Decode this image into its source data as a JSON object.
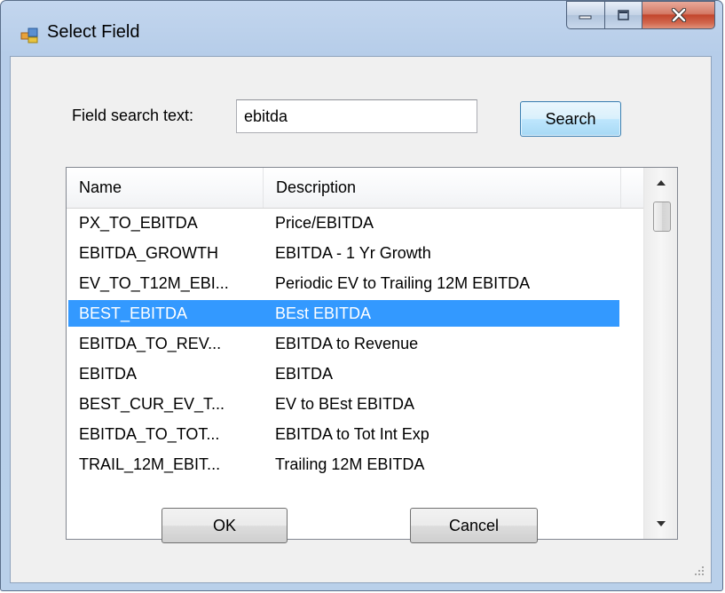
{
  "window": {
    "title": "Select Field",
    "colors": {
      "selection": "#3399ff",
      "title_bar": "#b9d0ea",
      "close_button": "#c2452c"
    }
  },
  "search": {
    "label": "Field search text:",
    "value": "ebitda",
    "button_label": "Search"
  },
  "list": {
    "columns": [
      "Name",
      "Description"
    ],
    "rows": [
      {
        "name": "PX_TO_EBITDA",
        "description": "Price/EBITDA",
        "selected": false
      },
      {
        "name": "EBITDA_GROWTH",
        "description": "EBITDA - 1 Yr Growth",
        "selected": false
      },
      {
        "name": "EV_TO_T12M_EBI...",
        "description": "Periodic EV to Trailing 12M EBITDA",
        "selected": false
      },
      {
        "name": "BEST_EBITDA",
        "description": "BEst EBITDA",
        "selected": true
      },
      {
        "name": "EBITDA_TO_REV...",
        "description": "EBITDA to Revenue",
        "selected": false
      },
      {
        "name": "EBITDA",
        "description": "EBITDA",
        "selected": false
      },
      {
        "name": "BEST_CUR_EV_T...",
        "description": "EV to BEst EBITDA",
        "selected": false
      },
      {
        "name": "EBITDA_TO_TOT...",
        "description": "EBITDA to Tot Int Exp",
        "selected": false
      },
      {
        "name": "TRAIL_12M_EBIT...",
        "description": "Trailing 12M EBITDA",
        "selected": false
      }
    ]
  },
  "buttons": {
    "ok": "OK",
    "cancel": "Cancel"
  }
}
